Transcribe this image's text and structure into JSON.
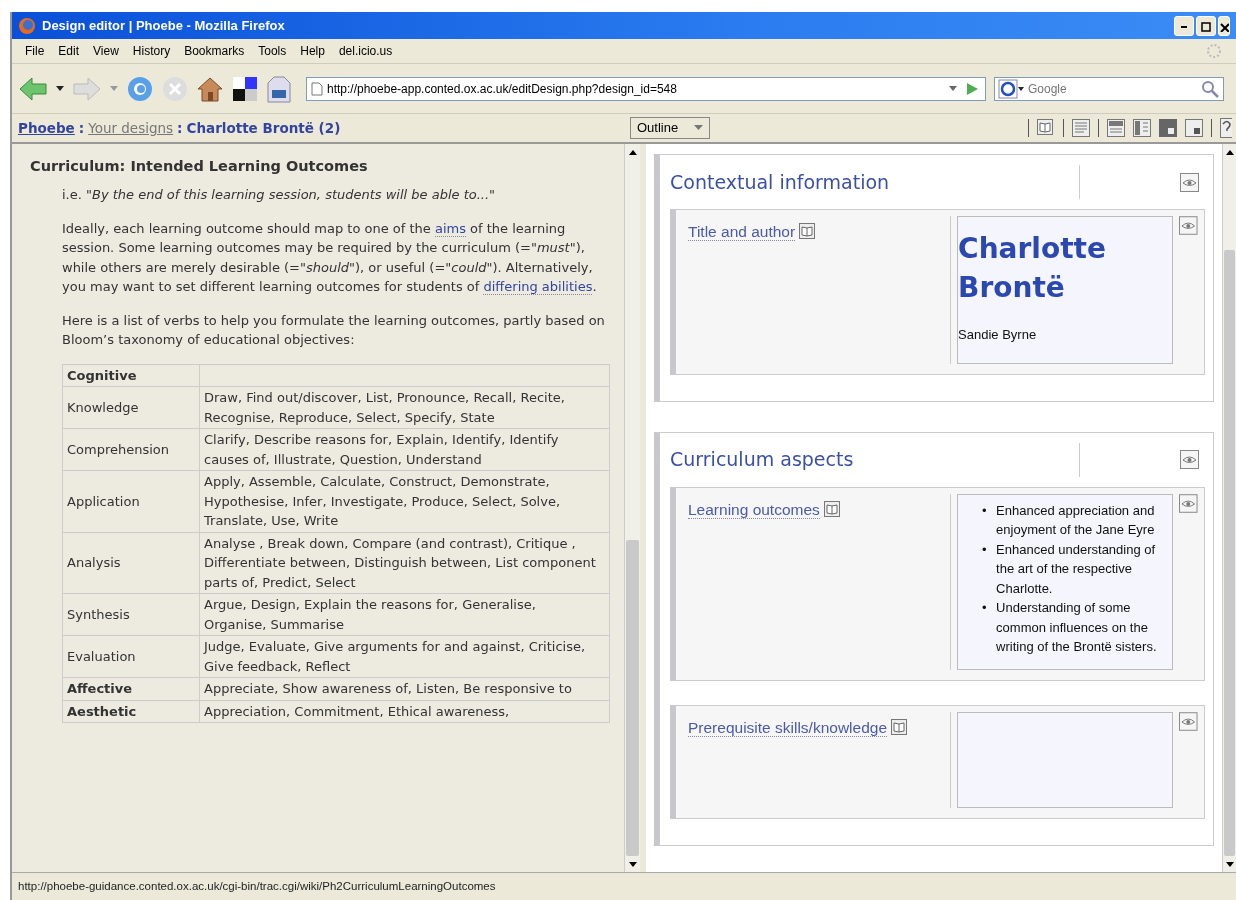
{
  "window": {
    "title": "Design editor | Phoebe - Mozilla Firefox"
  },
  "menu": [
    "File",
    "Edit",
    "View",
    "History",
    "Bookmarks",
    "Tools",
    "Help",
    "del.icio.us"
  ],
  "toolbar": {
    "url": "http://phoebe-app.conted.ox.ac.uk/editDesign.php?design_id=548",
    "search": {
      "placeholder": "Google"
    }
  },
  "breadcrumb": {
    "separator": ":",
    "items": [
      {
        "label": "Phoebe",
        "kind": "link"
      },
      {
        "label": "Your designs",
        "kind": "visited"
      },
      {
        "label": "Charlotte Brontë (2)",
        "kind": "current"
      }
    ]
  },
  "view_menu": {
    "label": "Outline"
  },
  "guidance": {
    "title": "Curriculum: Intended Learning Outcomes",
    "intro": "i.e. *\"By the end of this learning session, students will be able to...\"*",
    "paragraphs": [
      [
        {
          "kind": "text",
          "text": "Ideally, each learning outcome should map to one of the "
        },
        {
          "kind": "link",
          "text": "aims"
        },
        {
          "kind": "text",
          "text": " of the learning session. Some learning outcomes may be required by the curriculum (=*\"must\"*), while others are merely desirable (=*\"should\"*), or useful (=*\"could\"*). Alternatively, you may want to set different learning outcomes for students of "
        },
        {
          "kind": "link",
          "text": "differing abilities"
        },
        {
          "kind": "text",
          "text": "."
        }
      ],
      [
        {
          "kind": "text",
          "text": "Here is a list of verbs to help you formulate the learning outcomes, partly based on Bloom’s taxonomy of educational objectives:"
        }
      ]
    ],
    "table": {
      "rows": [
        {
          "category": "Cognitive",
          "verbs": "",
          "heading": true
        },
        {
          "category": "Knowledge",
          "verbs": "Draw, Find out/discover, List, Pronounce, Recall, Recite, Recognise, Reproduce, Select, Specify, State",
          "heading": false
        },
        {
          "category": "Comprehension",
          "verbs": "Clarify, Describe reasons for, Explain, Identify, Identify causes of, Illustrate, Question, Understand",
          "heading": false
        },
        {
          "category": "Application",
          "verbs": "Apply, Assemble, Calculate, Construct, Demonstrate, Hypothesise, Infer, Investigate, Produce, Select, Solve, Translate, Use, Write",
          "heading": false
        },
        {
          "category": "Analysis",
          "verbs": "Analyse , Break down, Compare (and contrast), Critique , Differentiate between, Distinguish between, List component parts of, Predict, Select",
          "heading": false
        },
        {
          "category": "Synthesis",
          "verbs": "Argue, Design, Explain the reasons for, Generalise, Organise, Summarise",
          "heading": false
        },
        {
          "category": "Evaluation",
          "verbs": "Judge, Evaluate, Give arguments for and against, Criticise, Give feedback, Reflect",
          "heading": false
        },
        {
          "category": "Affective",
          "verbs": "Appreciate, Show awareness of, Listen, Be responsive to",
          "heading": true
        },
        {
          "category": "Aesthetic",
          "verbs": "Appreciation, Commitment, Ethical awareness,",
          "heading": true
        }
      ]
    }
  },
  "sections": [
    {
      "title": "Contextual information",
      "fields": [
        {
          "label": "Title and author",
          "kind": "title",
          "title": "Charlotte Brontë",
          "subtitle": "Sandie Byrne"
        }
      ]
    },
    {
      "title": "Curriculum aspects",
      "fields": [
        {
          "label": "Learning outcomes",
          "kind": "list",
          "bullet": "•",
          "items": [
            "Enhanced appreciation and enjoyment of the Jane Eyre",
            "Enhanced understanding of the art of the respective Charlotte.",
            "Understanding of some common influences on the writing of the Brontë sisters."
          ]
        },
        {
          "label": "Prerequisite skills/knowledge",
          "kind": "empty"
        }
      ]
    }
  ],
  "status_bar": {
    "text": "http://phoebe-guidance.conted.ox.ac.uk/cgi-bin/trac.cgi/wiki/Ph2CurriculumLearningOutcomes"
  }
}
